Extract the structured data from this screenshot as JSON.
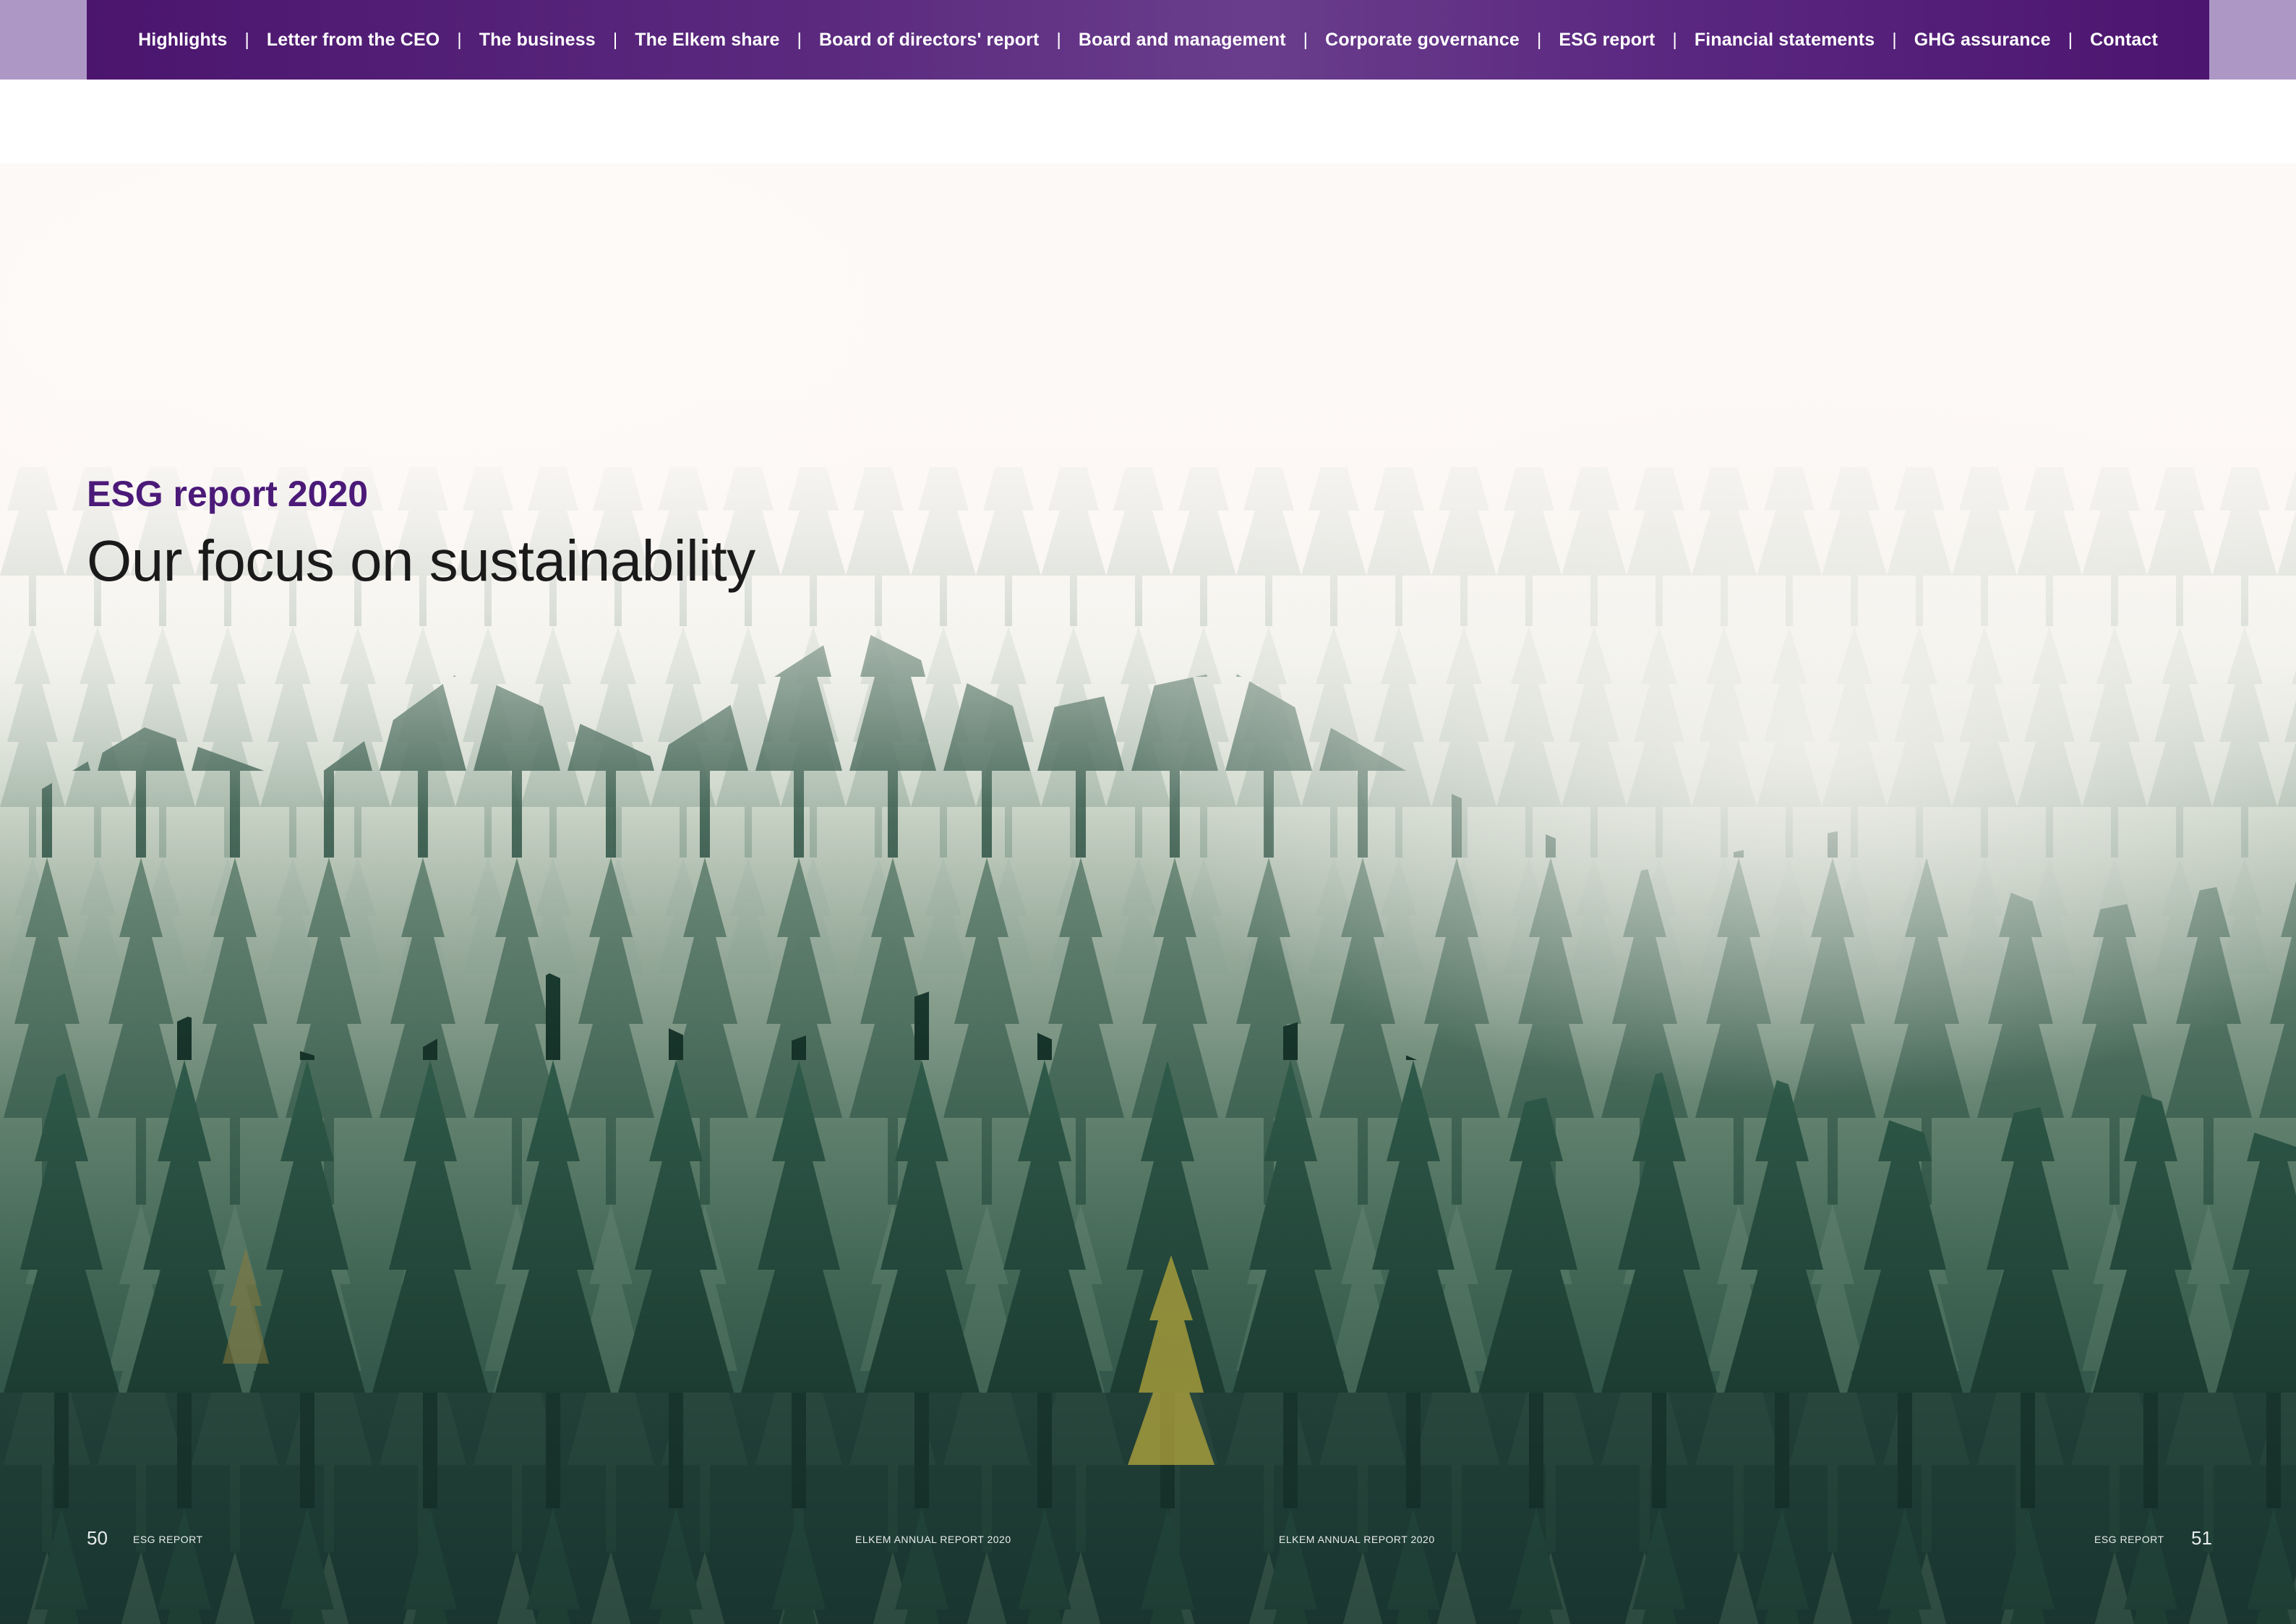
{
  "navigation": {
    "items": [
      {
        "label": "Highlights"
      },
      {
        "label": "Letter from the CEO"
      },
      {
        "label": "The business"
      },
      {
        "label": "The Elkem share"
      },
      {
        "label": "Board of directors' report"
      },
      {
        "label": "Board and management"
      },
      {
        "label": "Corporate governance"
      },
      {
        "label": "ESG report"
      },
      {
        "label": "Financial statements"
      },
      {
        "label": "GHG assurance"
      },
      {
        "label": "Contact"
      }
    ],
    "separator": "|"
  },
  "hero": {
    "kicker": "ESG report 2020",
    "title": "Our focus on sustainability"
  },
  "footer": {
    "left": {
      "page_number": "50",
      "section": "ESG REPORT",
      "publication": "ELKEM ANNUAL REPORT 2020"
    },
    "right": {
      "page_number": "51",
      "section": "ESG REPORT",
      "publication": "ELKEM ANNUAL REPORT 2020"
    }
  },
  "colors": {
    "nav_background": "#4b156e",
    "nav_side_band": "#ad98c5",
    "kicker": "#4b1a78",
    "title": "#1a1a1a"
  }
}
